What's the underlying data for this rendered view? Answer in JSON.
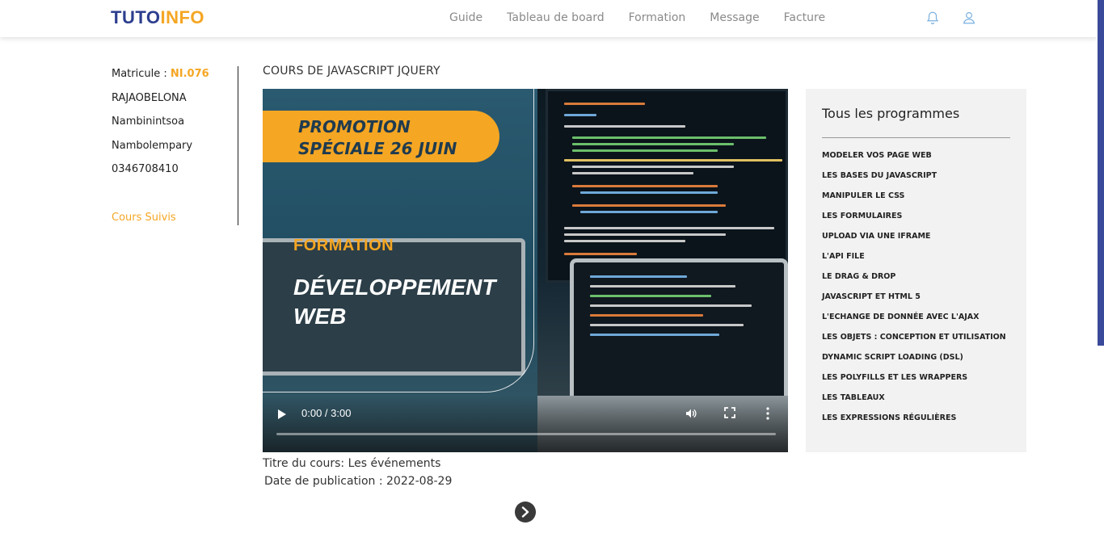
{
  "header": {
    "logo_part1": "TUTO",
    "logo_part2": "INFO",
    "nav": [
      "Guide",
      "Tableau de board",
      "Formation",
      "Message",
      "Facture"
    ],
    "icons": [
      "bell-icon",
      "user-icon"
    ]
  },
  "profile": {
    "matricule_label": "Matricule : ",
    "matricule_value": "NI.076",
    "lastname": "RAJAOBELONA",
    "firstname": "Nambinintsoa",
    "location": "Nambolempary",
    "phone": "0346708410",
    "courses_link": "Cours Suivis"
  },
  "course": {
    "title": "COURS DE JAVASCRIPT JQUERY",
    "video": {
      "promo_line1": "PROMOTION",
      "promo_line2": "SPÉCIALE 26 JUIN",
      "formation": "FORMATION",
      "dev_line1": "DÉVELOPPEMENT",
      "dev_line2": "WEB",
      "time": "0:00 / 3:00",
      "progress": 0.0
    },
    "caption_title": "Titre du cours: Les événements",
    "caption_date": " Date de publication : 2022-08-29"
  },
  "programmes": {
    "title": "Tous les programmes",
    "items": [
      "MODELER VOS PAGE WEB",
      "LES BASES DU JAVASCRIPT",
      "MANIPULER LE CSS",
      "LES FORMULAIRES",
      "UPLOAD VIA UNE IFRAME",
      "L'API FILE",
      "LE DRAG & DROP",
      "JAVASCRIPT ET HTML 5",
      "L'ECHANGE DE DONNÉE AVEC L'AJAX",
      "LES OBJETS : CONCEPTION ET UTILISATION",
      "DYNAMIC SCRIPT LOADING (DSL)",
      "LES POLYFILLS ET LES WRAPPERS",
      "LES TABLEAUX",
      "LES EXPRESSIONS RÉGULIÈRES"
    ]
  },
  "colors": {
    "brand_blue": "#2c3e8f",
    "brand_orange": "#f5a623"
  }
}
